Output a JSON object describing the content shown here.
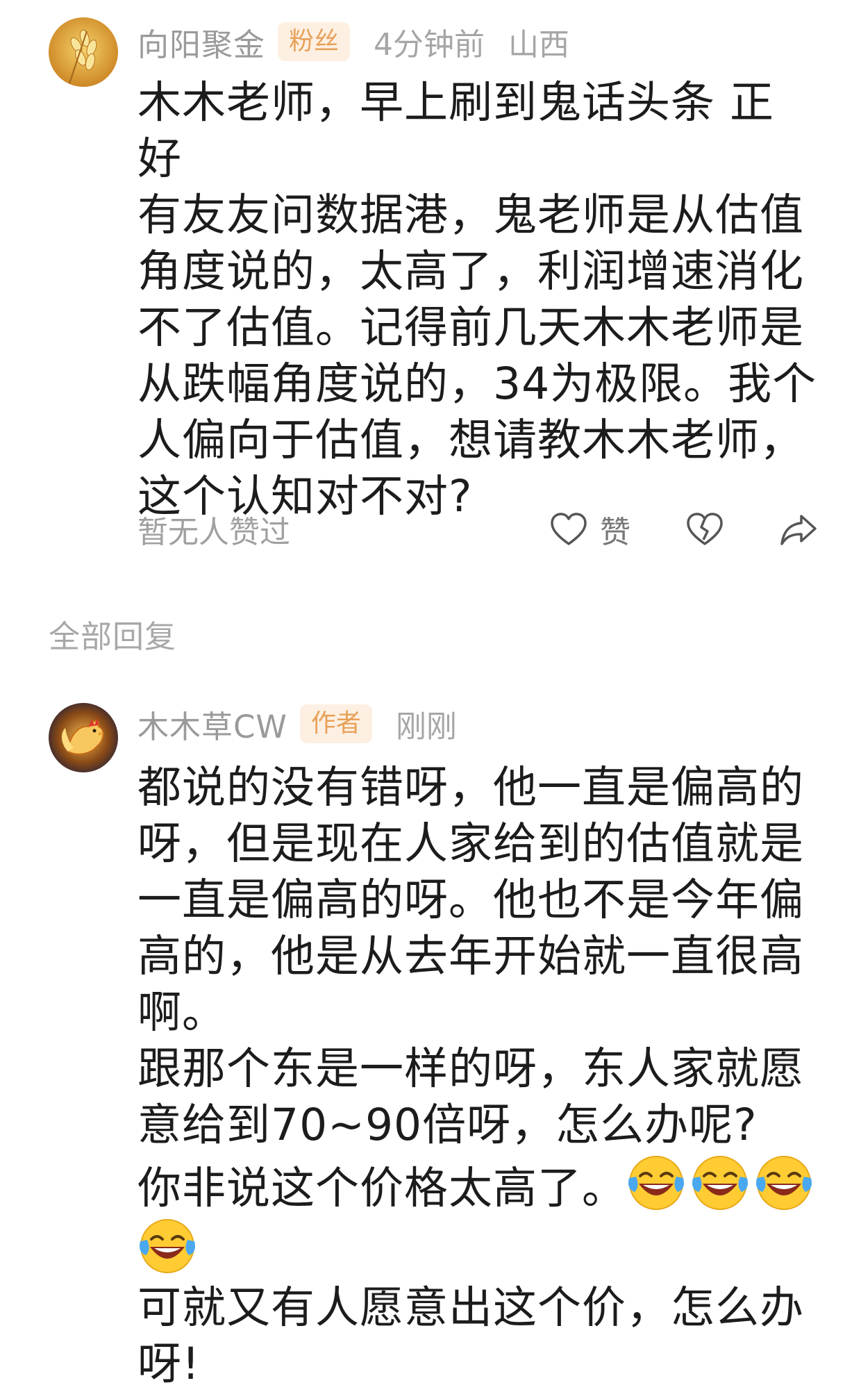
{
  "comment": {
    "username": "向阳聚金",
    "tag": "粉丝",
    "time": "4分钟前",
    "location": "山西",
    "text": "木木老师，早上刷到鬼话头条 正好\n有友友问数据港，鬼老师是从估值\n角度说的，太高了，利润增速消化\n不了估值。记得前几天木木老师是\n从跌幅角度说的，34为极限。我个\n人偏向于估值，想请教木木老师，\n这个认知对不对?",
    "likes_status": "暂无人赞过",
    "like_label": "赞",
    "icons": {
      "like": "heart-icon",
      "dislike": "broken-heart-icon",
      "share": "share-arrow-icon"
    }
  },
  "replies_section": {
    "title": "全部回复"
  },
  "reply": {
    "username": "木木草CW",
    "tag": "作者",
    "time": "刚刚",
    "text_part1": "都说的没有错呀，他一直是偏高的\n呀，但是现在人家给到的估值就是\n一直是偏高的呀。他也不是今年偏\n高的，他是从去年开始就一直很高\n啊。\n跟那个东是一样的呀，东人家就愿\n意给到70~90倍呀，怎么办呢?\n你非说这个价格太高了。",
    "emoji_count": 4,
    "emoji_name": "laughing-tears-emoji",
    "text_part2": "可就又有人愿意出这个价，怎么办\n呀!"
  },
  "colors": {
    "tag_bg": "#fdf0e2",
    "tag_text": "#e8a15a",
    "meta_text": "#a0a0a0",
    "body_text": "#1c1c1c"
  }
}
